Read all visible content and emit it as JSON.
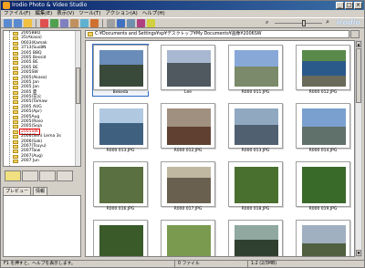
{
  "window": {
    "title": "Irodio Photo & Video Studio",
    "controls": [
      "_",
      "□",
      "×"
    ]
  },
  "menu": [
    "ファイル(F)",
    "編集(E)",
    "表示(V)",
    "ツール(T)",
    "アクション(A)",
    "ヘルプ(H)"
  ],
  "logo": "irodio",
  "zoom": {
    "position": 0.62
  },
  "tree": {
    "items": [
      "2005BBQ",
      "35(Akasa)",
      "0603(Kamak",
      "3713(Sus8N",
      "2005 BBQ",
      "2005 Bessid",
      "2005 BE",
      "2005 BE",
      "2005SW",
      "2005(Akasa)",
      "2005 Jan",
      "2005 Jan",
      "2005 夏",
      "2005(花火",
      "2005(Tamaw",
      "2005 AUG",
      "2005(Apr)",
      "2005Aug",
      "2005(Roso",
      "2005(Soja",
      "2005SW",
      "2006(Sen) Lema 3s",
      "2006(Sak)",
      "2007(Tsuyu)",
      "2007Taiw",
      "2007(Aug)",
      "2007 Jun"
    ],
    "selected_index": 20
  },
  "preview_tabs": [
    "プレビュー",
    "情報"
  ],
  "path": "C:¥Documents and Settings¥xp¥デスクトップ¥My Documents¥画像¥2006SW",
  "thumbnails": [
    {
      "name": "Bekeda",
      "selected": true
    },
    {
      "name": "Lee",
      "selected": false
    },
    {
      "name": "R000 011.JPG",
      "selected": false
    },
    {
      "name": "R000 012.JPG",
      "selected": false
    },
    {
      "name": "R000 013.JPG",
      "selected": false
    },
    {
      "name": "R000 012.JPG",
      "selected": false
    },
    {
      "name": "R000 013.JPG",
      "selected": false
    },
    {
      "name": "R000 014.JPG",
      "selected": false
    },
    {
      "name": "R000 016.JPG",
      "selected": false
    },
    {
      "name": "R000 017.JPG",
      "selected": false
    },
    {
      "name": "R000 018.JPG",
      "selected": false
    },
    {
      "name": "R000 019.JPG",
      "selected": false
    },
    {
      "name": "",
      "selected": false
    },
    {
      "name": "",
      "selected": false
    },
    {
      "name": "",
      "selected": false
    },
    {
      "name": "",
      "selected": false
    }
  ],
  "status": {
    "left": "F1 を押すと、ヘルプを表示します。",
    "mid": "0 ファイル",
    "right": "1:2 (2/3MB)"
  },
  "colors": {
    "titlebar_start": "#0a246a",
    "titlebar_end": "#3a6ea5",
    "selection_red": "#e00000",
    "selection_blue": "#316ac5"
  }
}
